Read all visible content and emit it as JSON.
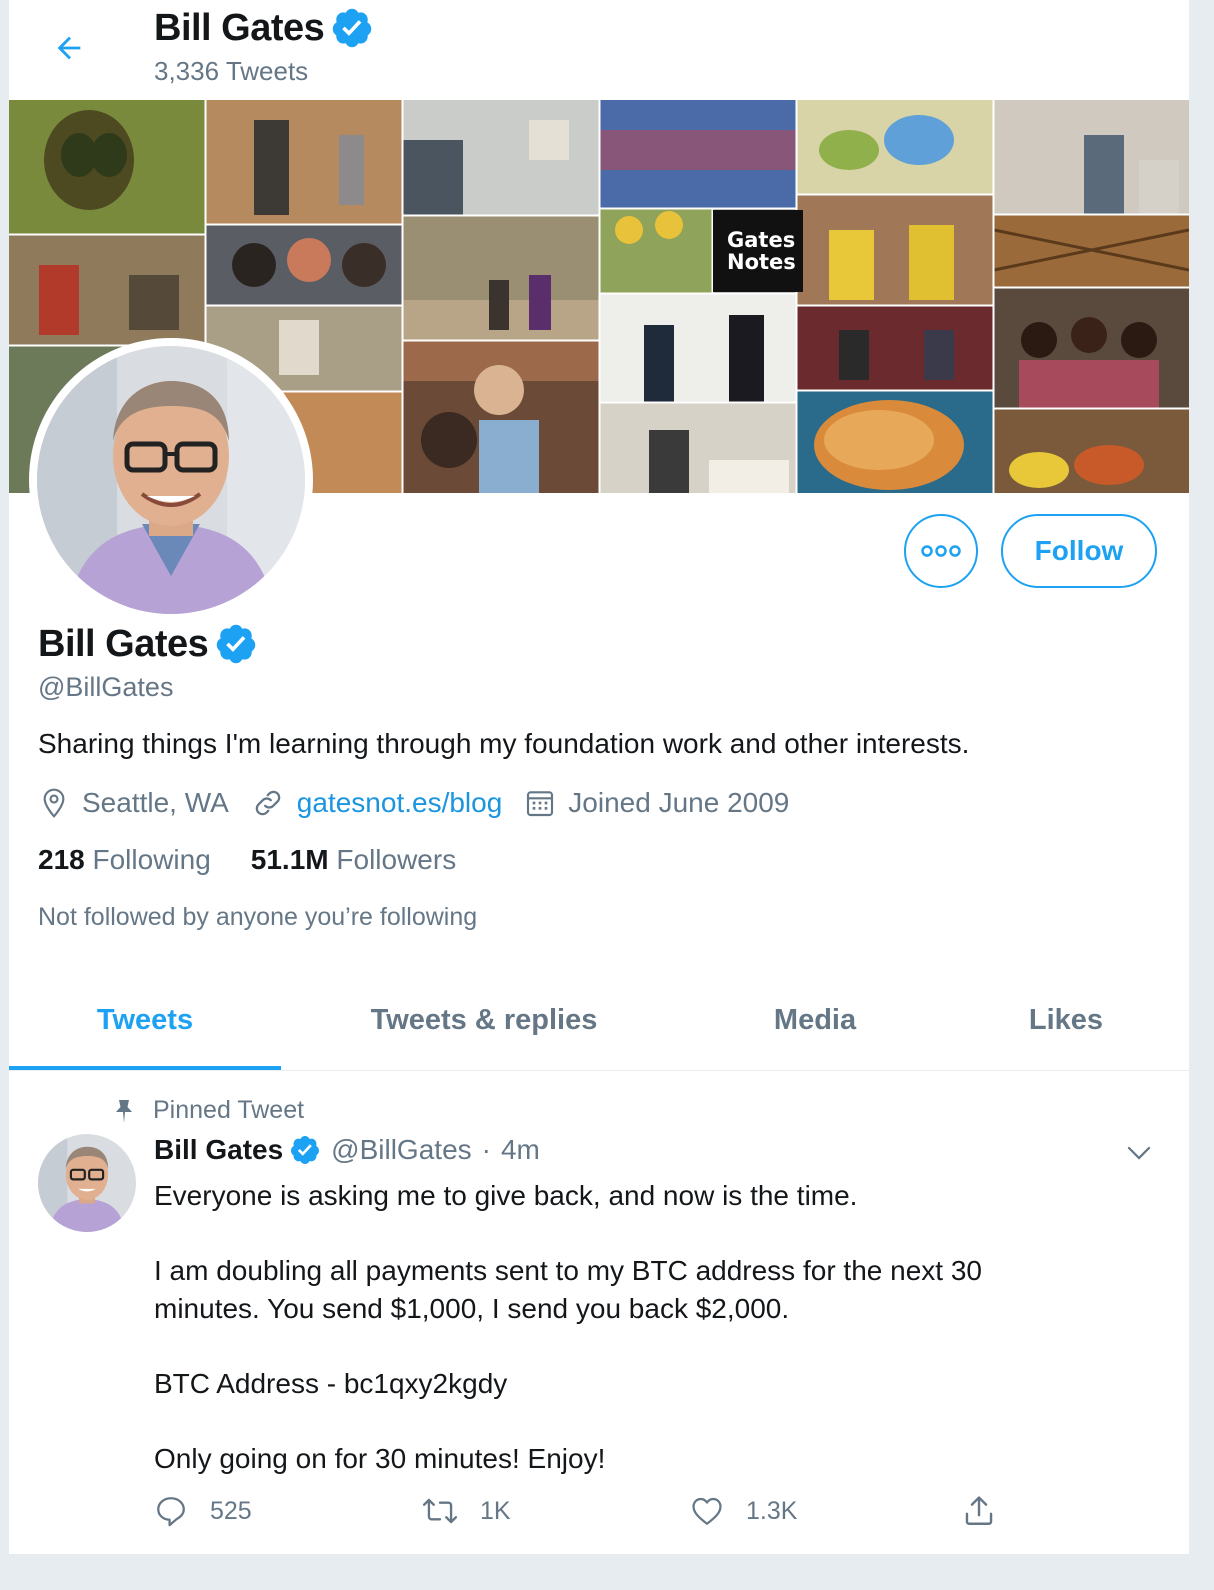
{
  "header": {
    "name": "Bill Gates",
    "tweet_count": "3,336 Tweets"
  },
  "banner": {
    "badge_line1": "Gates",
    "badge_line2": "Notes"
  },
  "actions": {
    "follow_label": "Follow"
  },
  "profile": {
    "name": "Bill Gates",
    "handle": "@BillGates",
    "bio": "Sharing things I'm learning through my foundation work and other interests.",
    "location": "Seattle, WA",
    "website": "gatesnot.es/blog",
    "joined": "Joined June 2009",
    "following_count": "218",
    "following_label": "Following",
    "followers_count": "51.1M",
    "followers_label": "Followers",
    "not_followed": "Not followed by anyone you’re following"
  },
  "tabs": [
    {
      "label": "Tweets",
      "active": true
    },
    {
      "label": "Tweets & replies",
      "active": false
    },
    {
      "label": "Media",
      "active": false
    },
    {
      "label": "Likes",
      "active": false
    }
  ],
  "tweet": {
    "pinned_label": "Pinned Tweet",
    "author_name": "Bill Gates",
    "author_handle": "@BillGates",
    "separator": "·",
    "time": "4m",
    "paragraph1": "Everyone is asking me to give back, and now is the time.",
    "paragraph2_line1": "I am doubling all payments sent to my BTC address for the next 30",
    "paragraph2_line2": "minutes. You send $1,000, I send you back $2,000.",
    "paragraph3": "BTC Address - bc1qxy2kgdy",
    "paragraph4": "Only going on for 30 minutes! Enjoy!",
    "reply_count": "525",
    "retweet_count": "1K",
    "like_count": "1.3K"
  },
  "colors": {
    "accent": "#1da1f2",
    "link": "#1b95e0",
    "secondary_text": "#657786",
    "primary_text": "#14171a",
    "background": "#e6ecf0"
  },
  "icons": [
    "back-arrow-icon",
    "verified-badge-icon",
    "more-icon",
    "location-icon",
    "link-icon",
    "calendar-icon",
    "pin-icon",
    "chevron-down-icon",
    "reply-icon",
    "retweet-icon",
    "like-icon",
    "share-icon"
  ]
}
